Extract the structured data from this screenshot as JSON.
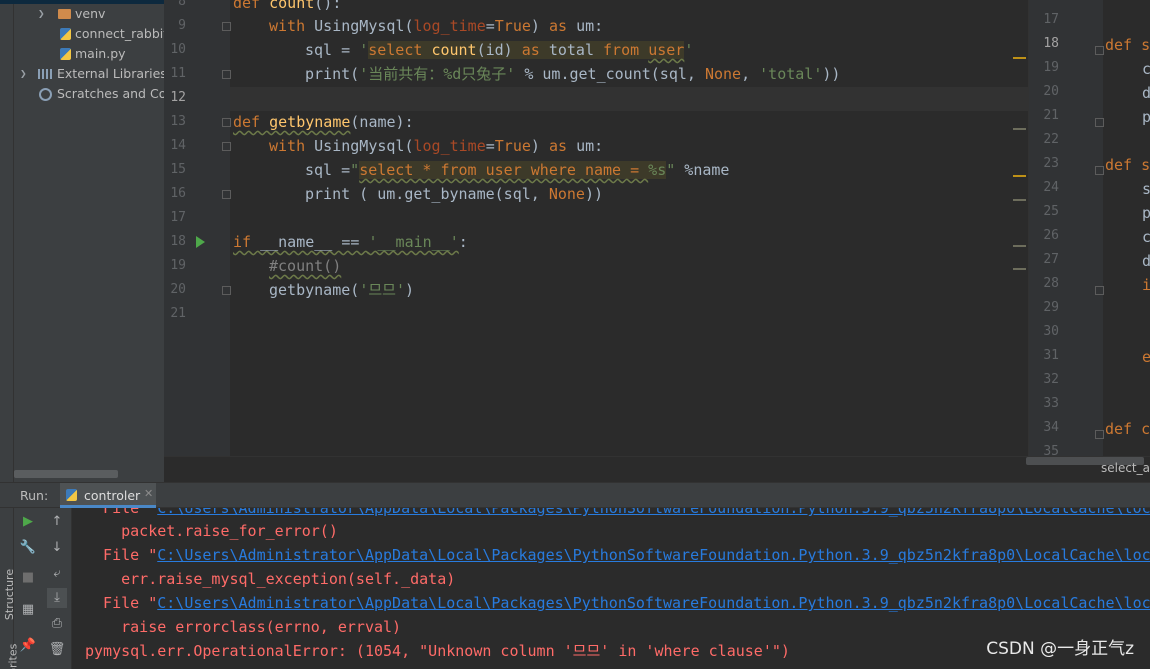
{
  "project_tree": {
    "items": [
      {
        "label": "venv",
        "type": "folder"
      },
      {
        "label": "connect_rabbitmq.py",
        "type": "py"
      },
      {
        "label": "main.py",
        "type": "py"
      },
      {
        "label": "External Libraries",
        "type": "libs"
      },
      {
        "label": "Scratches and Consoles",
        "type": "scratches"
      }
    ]
  },
  "editor": {
    "line_numbers": [
      "8",
      "9",
      "10",
      "11",
      "12",
      "13",
      "14",
      "15",
      "16",
      "17",
      "18",
      "19",
      "20",
      "21"
    ],
    "current_line": "12",
    "lines": {
      "l8": {
        "kw": "def ",
        "fn": "count",
        "rest": "():"
      },
      "l9": {
        "kw": "with ",
        "call": "UsingMysql(",
        "param": "log_time",
        "eq": "=",
        "val": "True",
        "close": ") ",
        "kw2": "as ",
        "var": "um:"
      },
      "l10": {
        "a": "sql = ",
        "q1": "'",
        "s1": "select ",
        "s2": "count",
        "s3": "(id) ",
        "s4": "as ",
        "s5": "total ",
        "s6": "from ",
        "s7": "user",
        "q2": "'"
      },
      "l11": {
        "a": "print(",
        "str": "'当前共有：%d只兔子'",
        "b": " % um.get_count(sql, ",
        "none": "None",
        "c": ", ",
        "str2": "'total'",
        "d": "))"
      },
      "l13": {
        "kw": "def ",
        "fn": "getbyname",
        "rest": "(name):"
      },
      "l14": {
        "kw": "with ",
        "call": "UsingMysql(",
        "param": "log_time",
        "eq": "=",
        "val": "True",
        "close": ") ",
        "kw2": "as ",
        "var": "um:"
      },
      "l15": {
        "a": "sql =",
        "q1": "\"",
        "sql": "select * from user where name = ",
        "fmt": "%s",
        "q2": "\"",
        "b": " %name"
      },
      "l16": {
        "a": "print ( um.get_byname(sql, ",
        "none": "None",
        "b": "))"
      },
      "l18": {
        "kw": "if ",
        "b": "__name__ == ",
        "str": "'__main__'",
        "c": ":"
      },
      "l19": {
        "cmt": "#count()"
      },
      "l20": {
        "a": "getbyname(",
        "str": "'므므'",
        "b": ")"
      }
    }
  },
  "editor2": {
    "line_numbers": [
      "17",
      "18",
      "19",
      "20",
      "21",
      "22",
      "23",
      "24",
      "25",
      "26",
      "27",
      "28",
      "29",
      "30",
      "31",
      "32",
      "33",
      "34",
      "35"
    ],
    "snippets": {
      "l18": "def s",
      "l19": "c",
      "l20": "d",
      "l21": "p",
      "l23": "def s",
      "l24": "s",
      "l25": "p",
      "l26": "c",
      "l27": "d",
      "l28": "i",
      "l31": "e",
      "l34": "def c"
    },
    "breadcrumb": "select_a"
  },
  "run_panel": {
    "label": "Run:",
    "tab": "controler",
    "console": {
      "line0_prefix": "  File \"",
      "line0_link": "C:\\Users\\Administrator\\AppData\\Local\\Packages\\PythonSoftwareFoundation.Python.3.9_qbz5n2kfra8p0\\LocalCache\\local",
      "line1": "    packet.raise_for_error()",
      "line2_prefix": "  File \"",
      "line2_link": "C:\\Users\\Administrator\\AppData\\Local\\Packages\\PythonSoftwareFoundation.Python.3.9_qbz5n2kfra8p0\\LocalCache\\local",
      "line3": "    err.raise_mysql_exception(self._data)",
      "line4_prefix": "  File \"",
      "line4_link": "C:\\Users\\Administrator\\AppData\\Local\\Packages\\PythonSoftwareFoundation.Python.3.9_qbz5n2kfra8p0\\LocalCache\\local",
      "line5": "    raise errorclass(errno, errval)",
      "line6": "pymysql.err.OperationalError: (1054, \"Unknown column '므므' in 'where clause'\")"
    }
  },
  "side_labels": {
    "structure": "Structure",
    "favorites": "Favorites"
  },
  "watermark": "CSDN @一身正气z",
  "colors": {
    "keyword": "#cc7832",
    "function": "#ffc66d",
    "string": "#6a8759",
    "number": "#6897bb",
    "error": "#ff6b68",
    "link": "#287bde"
  }
}
